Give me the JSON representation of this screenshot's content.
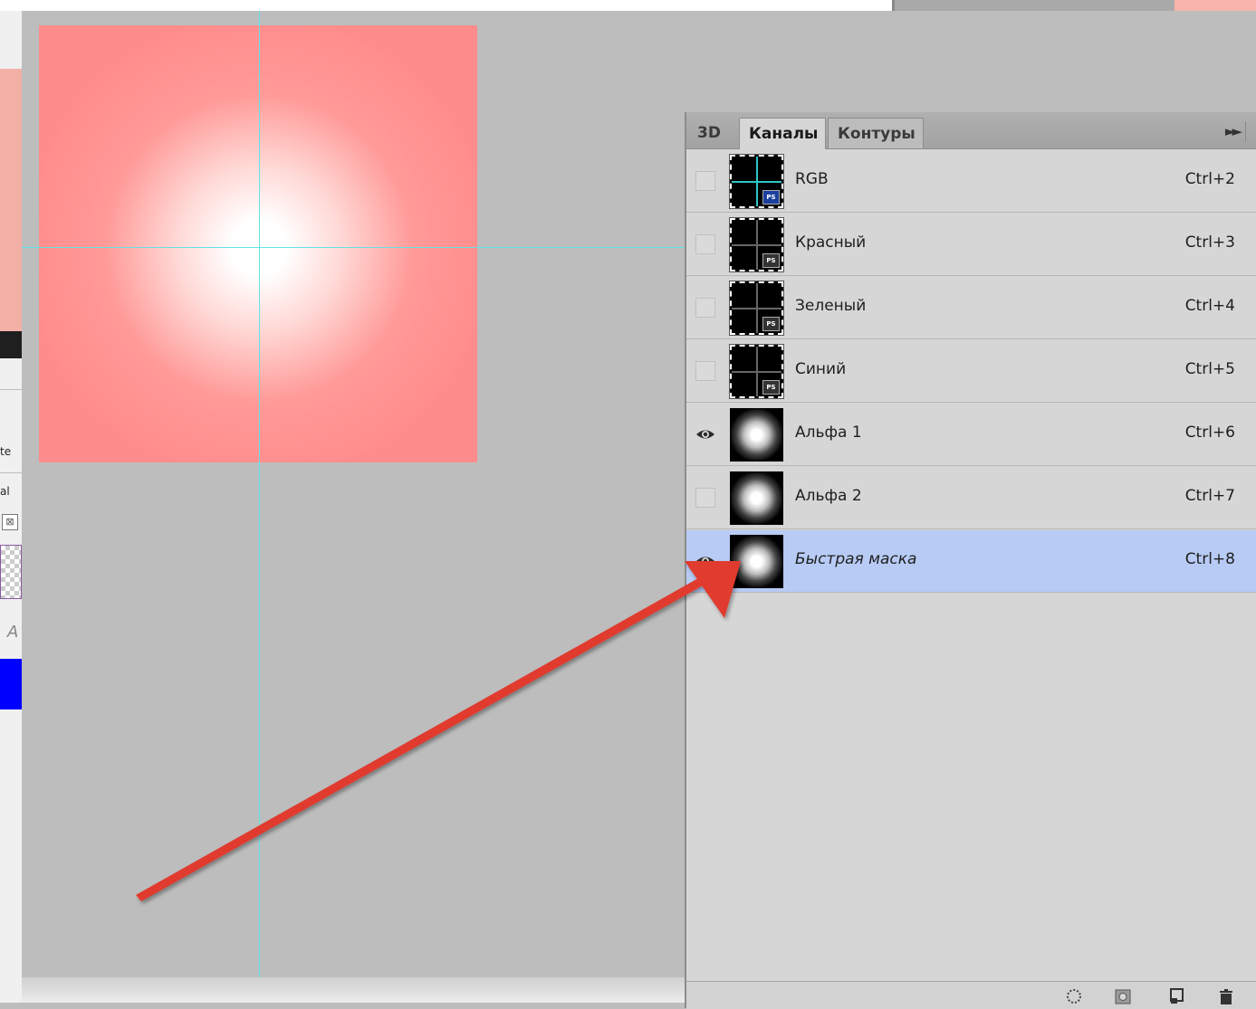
{
  "left_edge": {
    "text1": "te",
    "text2": "al",
    "box_glyph": "⊠",
    "partial_letter": "A"
  },
  "tabs": [
    {
      "label": "3D"
    },
    {
      "label": "Каналы"
    },
    {
      "label": "Контуры"
    }
  ],
  "panel_menu_icon": "double-arrow-right",
  "channels": [
    {
      "name": "RGB",
      "shortcut": "Ctrl+2",
      "visible": false,
      "thumb": "composite-cyan"
    },
    {
      "name": "Красный",
      "shortcut": "Ctrl+3",
      "visible": false,
      "thumb": "composite"
    },
    {
      "name": "Зеленый",
      "shortcut": "Ctrl+4",
      "visible": false,
      "thumb": "composite"
    },
    {
      "name": "Синий",
      "shortcut": "Ctrl+5",
      "visible": false,
      "thumb": "composite"
    },
    {
      "name": "Альфа 1",
      "shortcut": "Ctrl+6",
      "visible": true,
      "thumb": "alpha"
    },
    {
      "name": "Альфа 2",
      "shortcut": "Ctrl+7",
      "visible": false,
      "thumb": "alpha"
    },
    {
      "name": "Быстрая маска",
      "shortcut": "Ctrl+8",
      "visible": true,
      "thumb": "alpha",
      "selected": true
    }
  ],
  "thumb_badge": "PS",
  "colors": {
    "canvas_bg": "#bdbdbd",
    "selected_row": "#b7cbf5",
    "guide": "#63e3e6",
    "arrow": "#e03a2f",
    "doc_fill": "#ff8c8c"
  },
  "footer_icons": [
    "load-selection-icon",
    "save-selection-icon",
    "new-channel-icon",
    "trash-icon"
  ]
}
